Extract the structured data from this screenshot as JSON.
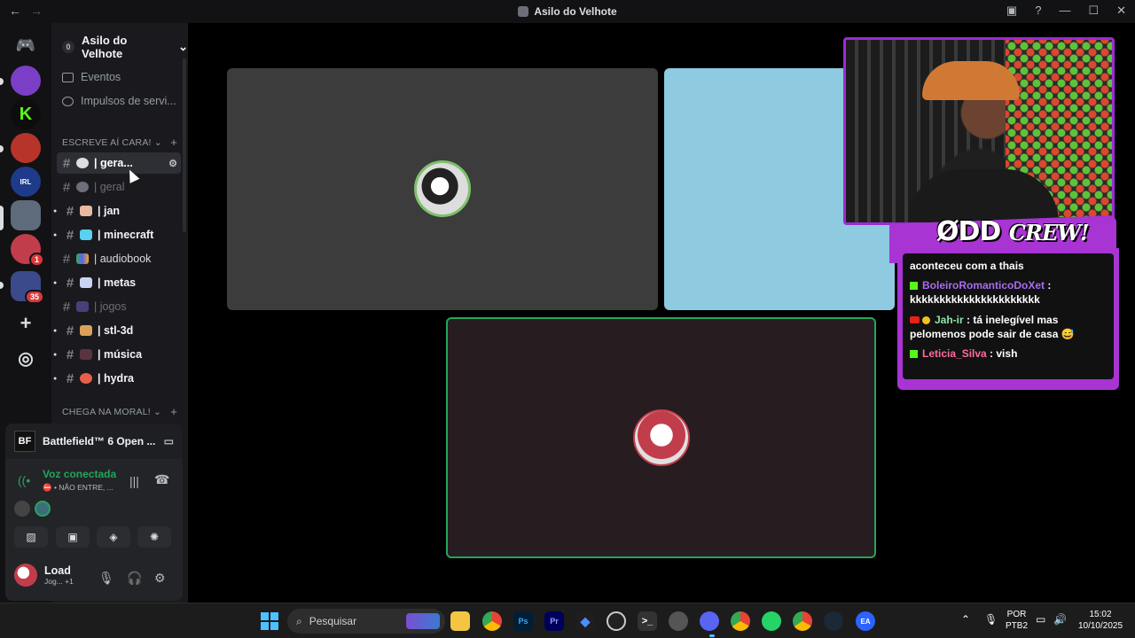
{
  "window": {
    "title": "Asilo do Velhote",
    "back": "←",
    "forward": "→",
    "inbox": "▣",
    "help": "?",
    "min": "—",
    "max": "☐",
    "close": "✕"
  },
  "server": {
    "name": "Asilo do Velhote",
    "boost_count": "0"
  },
  "rail": {
    "badges": {
      "server8": "1",
      "folder": "35"
    },
    "home": "◉",
    "add": "+",
    "discover": "◎"
  },
  "nav": {
    "events": "Eventos",
    "boosts": "Impulsos de servi..."
  },
  "categories": {
    "first": "ESCREVE AÍ CARA!",
    "second": "CHEGA NA MORAL!",
    "plus": "+"
  },
  "channels": [
    {
      "label": "| gera...",
      "state": "active"
    },
    {
      "label": "| geral",
      "state": "muted"
    },
    {
      "label": "| jan",
      "state": "unread"
    },
    {
      "label": "| minecraft",
      "state": "unread"
    },
    {
      "label": "| audiobook",
      "state": "normal"
    },
    {
      "label": "| metas",
      "state": "unread"
    },
    {
      "label": "| jogos",
      "state": "muted"
    },
    {
      "label": "| stl-3d",
      "state": "unread"
    },
    {
      "label": "| música",
      "state": "unread"
    },
    {
      "label": "| hydra",
      "state": "unread"
    }
  ],
  "activity": {
    "logo": "BF",
    "title": "Battlefield™ 6 Open ..."
  },
  "voice": {
    "status": "Voz conectada",
    "channel": "⛔ • NÃO ENTRE, ...",
    "signal": "((•"
  },
  "user": {
    "name": "Load",
    "status": "Jog... +1"
  },
  "overlay": {
    "brand": "ØDD",
    "brand_suffix": "CREW!",
    "chat": [
      {
        "user": "",
        "text": "aconteceu com a thais"
      },
      {
        "user": "BoleiroRomanticoDoXet",
        "text": " : kkkkkkkkkkkkkkkkkkkkkk"
      },
      {
        "user": "Jah-ir",
        "text": " : tá inelegível mas pelomenos pode sair de casa 😅"
      },
      {
        "user": "Leticia_Silva",
        "text": " : vish"
      }
    ]
  },
  "taskbar": {
    "search_placeholder": "Pesquisar",
    "lang": "POR",
    "layout": "PTB2",
    "time": "15:02",
    "date": "10/10/2025",
    "apps": [
      "Ps",
      "Pr"
    ]
  },
  "colors": {
    "accent_green": "#23a55a",
    "overlay_purple": "#a734d3",
    "mention_red": "#da373c"
  }
}
